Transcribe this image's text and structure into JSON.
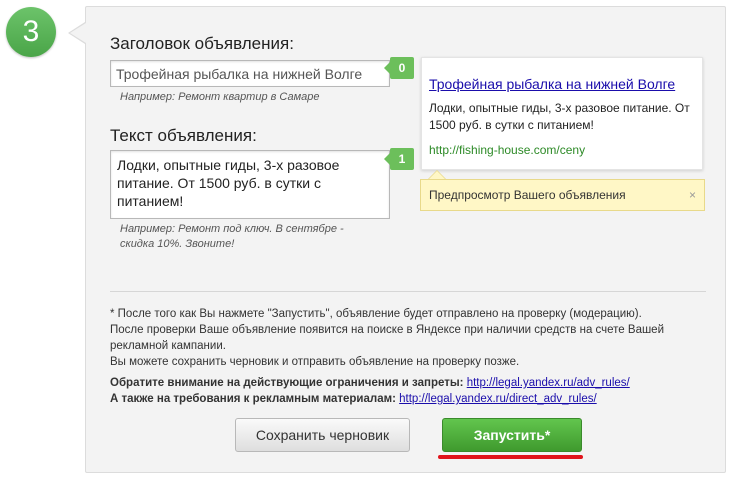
{
  "step": {
    "number": "3"
  },
  "title_section": {
    "label": "Заголовок объявления:",
    "value": "Трофейная рыбалка на нижней Волге",
    "counter": "0",
    "hint": "Например: Ремонт квартир в Самаре"
  },
  "text_section": {
    "label": "Текст объявления:",
    "value": "Лодки, опытные гиды, 3-х разовое питание. От 1500 руб. в сутки с питанием!",
    "counter": "1",
    "hint": "Например: Ремонт под ключ. В сентябре - скидка 10%. Звоните!"
  },
  "preview": {
    "title": "Трофейная рыбалка на нижней Волге",
    "body": "Лодки, опытные гиды, 3-х разовое питание. От 1500 руб. в сутки с питанием!",
    "url": "http://fishing-house.com/ceny",
    "note": "Предпросмотр Вашего объявления",
    "close_icon": "×"
  },
  "info": {
    "line1": "* После того как Вы нажмете \"Запустить\", объявление будет отправлено на проверку (модерацию).",
    "line2": "После проверки Ваше объявление появится на поиске в Яндексе при наличии средств на счете Вашей рекламной кампании.",
    "line3": "Вы можете сохранить черновик и отправить объявление на проверку позже."
  },
  "rules": {
    "restrictions_label": "Обратите внимание на действующие ограничения и запреты:",
    "restrictions_link": "http://legal.yandex.ru/adv_rules/",
    "requirements_label": "А также на требования к рекламным материалам:",
    "requirements_link": "http://legal.yandex.ru/direct_adv_rules/"
  },
  "buttons": {
    "save_draft": "Сохранить черновик",
    "launch": "Запустить*"
  },
  "colors": {
    "accent_green": "#4aa548",
    "link": "#1a0dab",
    "url_green": "#2d8a27",
    "highlight_red": "#e0141b"
  }
}
